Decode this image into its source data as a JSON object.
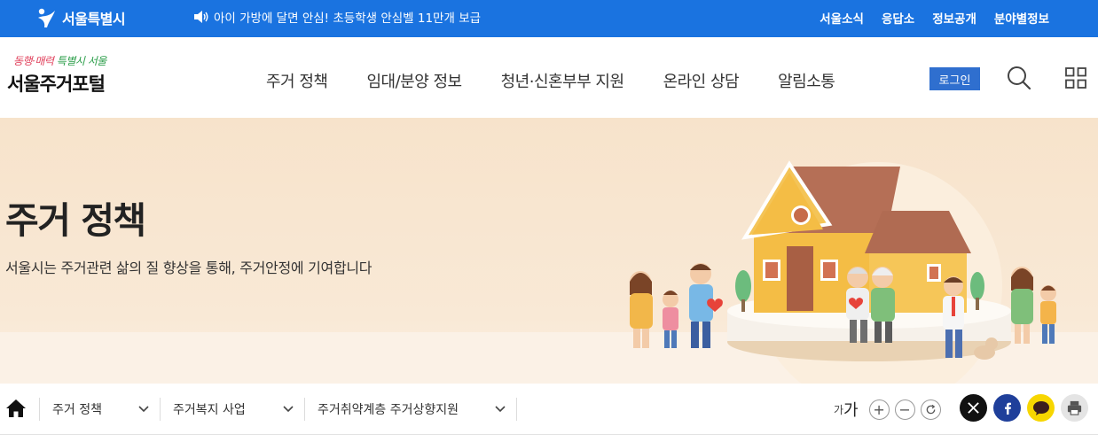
{
  "topbar": {
    "brand": "서울특별시",
    "notice": "아이 가방에 달면 안심! 초등학생 안심벨 11만개 보급",
    "quick_links": [
      "서울소식",
      "응답소",
      "정보공개",
      "분야별정보"
    ]
  },
  "header": {
    "slogan_a": "동행·매력 ",
    "slogan_b": "특별시 서울",
    "portal_name": "서울주거포털",
    "nav": [
      "주거 정책",
      "임대/분양 정보",
      "청년·신혼부부 지원",
      "온라인 상담",
      "알림소통"
    ],
    "login_label": "로그인"
  },
  "hero": {
    "title": "주거 정책",
    "subtitle": "서울시는 주거관련 삶의 질 향상을 통해, 주거안정에 기여합니다"
  },
  "location": {
    "crumbs": [
      "주거 정책",
      "주거복지 사업",
      "주거취약계층 주거상향지원"
    ]
  },
  "utility": {
    "font_small": "가",
    "font_big": "가",
    "zoom_in": "+",
    "zoom_out": "−"
  },
  "colors": {
    "topbar": "#1a73e0",
    "login": "#2f6fcf",
    "hero_bg": "#f7e3cb"
  }
}
